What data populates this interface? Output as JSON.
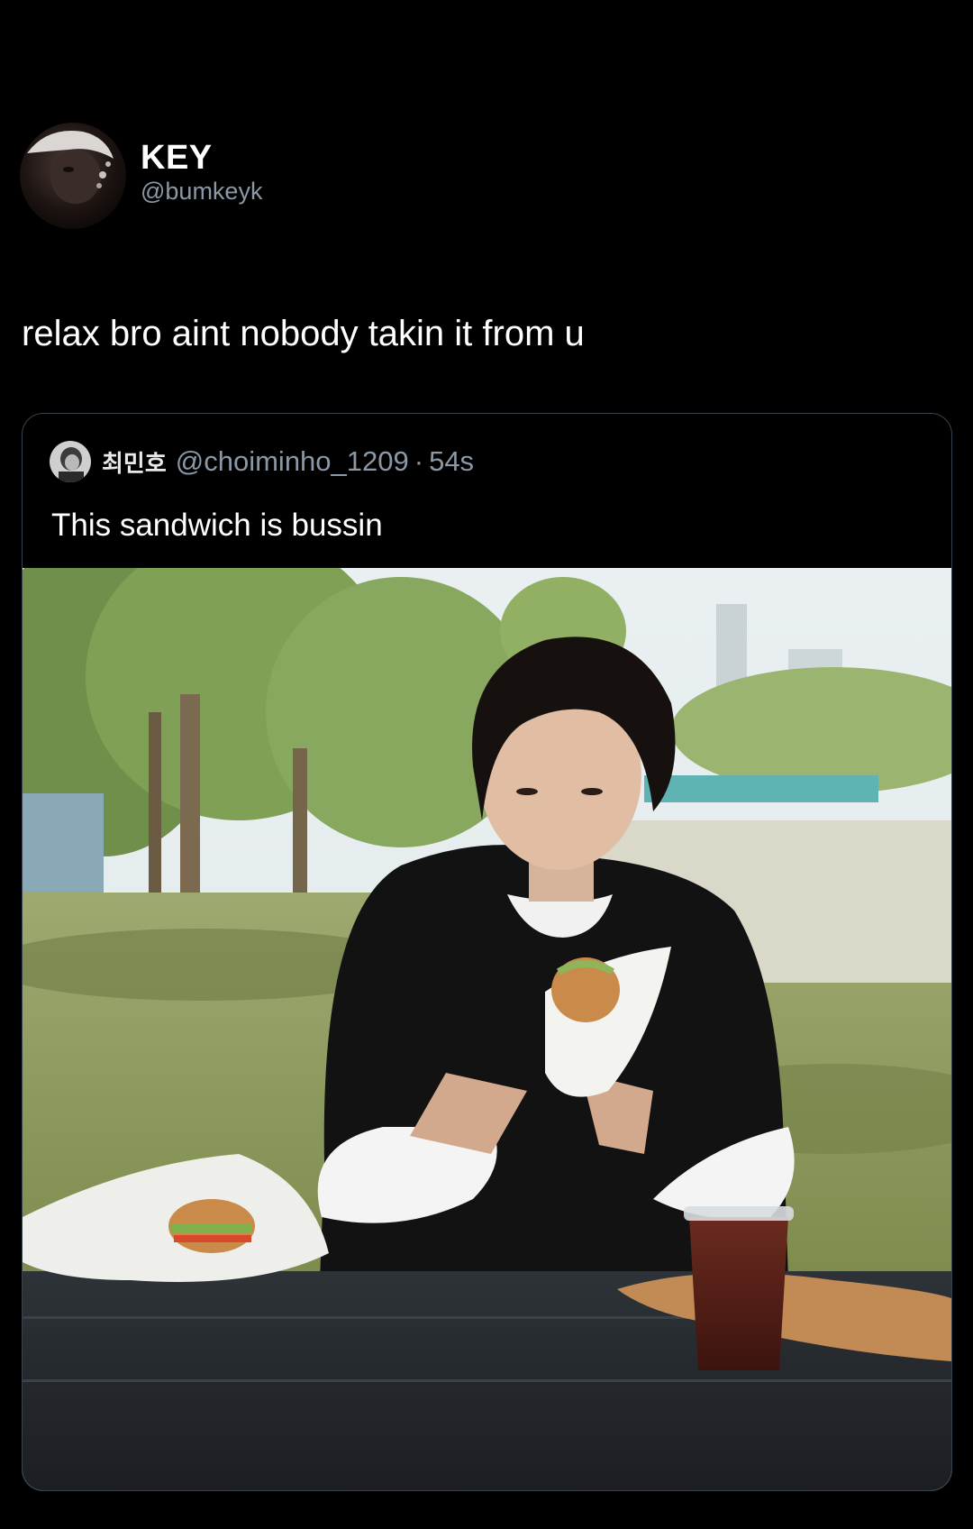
{
  "tweet": {
    "author": {
      "display_name": "KEY",
      "handle": "@bumkeyk",
      "avatar_icon": "profile-photo"
    },
    "text": "relax bro aint nobody takin it from u",
    "quote": {
      "author": {
        "display_name": "최민호",
        "handle": "@choiminho_1209",
        "avatar_icon": "profile-photo"
      },
      "separator": "·",
      "time": "54s",
      "text": "This sandwich is bussin",
      "media": {
        "type": "video-still"
      }
    }
  },
  "colors": {
    "background": "#000000",
    "primary_text": "#ffffff",
    "secondary_text": "#8b98a5",
    "card_border": "#38444d"
  }
}
